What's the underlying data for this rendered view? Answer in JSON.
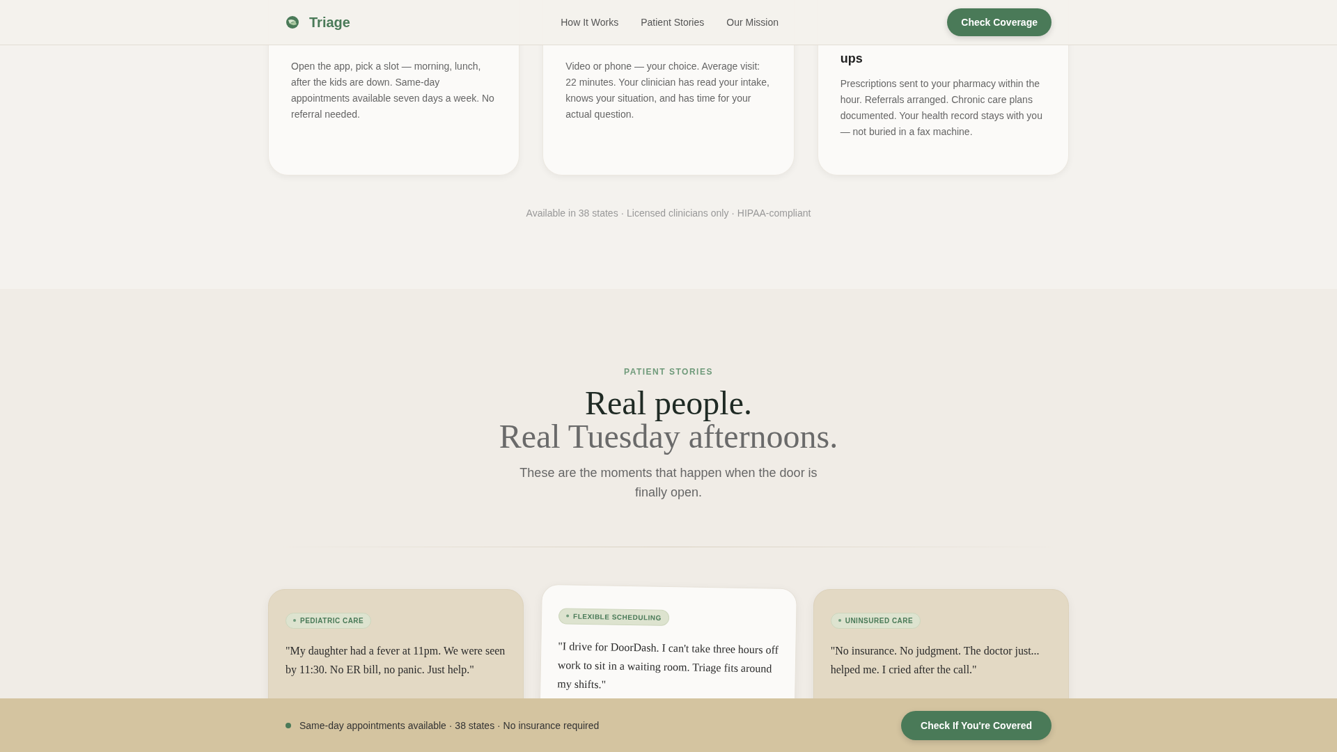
{
  "nav": {
    "brand": "Triage",
    "links": [
      "How It Works",
      "Patient Stories",
      "Our Mission"
    ],
    "cta": "Check Coverage"
  },
  "steps": [
    {
      "text": "Open the app, pick a slot — morning, lunch, after the kids are down. Same-day appointments available seven days a week. No referral needed."
    },
    {
      "text": "Video or phone — your choice. Average visit: 22 minutes. Your clinician has read your intake, knows your situation, and has time for your actual question."
    },
    {
      "title": "ups",
      "text": "Prescriptions sent to your pharmacy within the hour. Referrals arranged. Chronic care plans documented. Your health record stays with you — not buried in a fax machine."
    }
  ],
  "footnote": "Available in 38 states · Licensed clinicians only · HIPAA-compliant",
  "stories": {
    "eyebrow": "PATIENT STORIES",
    "title_line_1": "Real people.",
    "title_line_2": "Real Tuesday afternoons.",
    "subtitle": "These are the moments that happen when the door is finally open.",
    "cards": [
      {
        "kind": "tan",
        "tag": "PEDIATRIC CARE",
        "quote": "\"My daughter had a fever at 11pm. We were seen by 11:30. No ER bill, no panic. Just help.\""
      },
      {
        "kind": "light",
        "tag": "FLEXIBLE SCHEDULING",
        "quote": "\"I drive for DoorDash. I can't take three hours off work to sit in a waiting room. Triage fits around my shifts.\""
      },
      {
        "kind": "tan",
        "tag": "UNINSURED CARE",
        "quote": "\"No insurance. No judgment. The doctor just... helped me. I cried after the call.\""
      }
    ]
  },
  "bottom_bar": {
    "text": "Same-day appointments available · 38 states · No insurance required",
    "cta": "Check If You're Covered"
  }
}
